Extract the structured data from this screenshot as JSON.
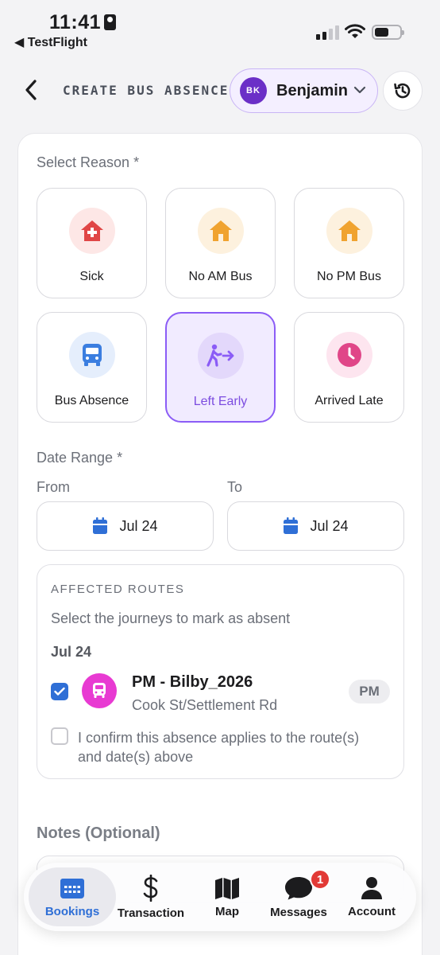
{
  "status_bar": {
    "time": "11:41",
    "back_app": "◀ TestFlight"
  },
  "header": {
    "title": "CREATE BUS ABSENCE",
    "user_initials": "BK",
    "user_name": "Benjamin"
  },
  "reason_section": {
    "label": "Select Reason *",
    "options": [
      {
        "label": "Sick",
        "icon": "house-medical-icon",
        "color": "#e04646",
        "bg": "#fde7e6",
        "selected": false
      },
      {
        "label": "No AM Bus",
        "icon": "house-icon",
        "color": "#f0a330",
        "bg": "#fdf1de",
        "selected": false
      },
      {
        "label": "No PM Bus",
        "icon": "house-icon",
        "color": "#f0a330",
        "bg": "#fdf1de",
        "selected": false
      },
      {
        "label": "Bus Absence",
        "icon": "bus-icon",
        "color": "#3b7ee0",
        "bg": "#e5eefc",
        "selected": false
      },
      {
        "label": "Left Early",
        "icon": "walking-person-icon",
        "color": "#8b5cf6",
        "bg": "#e3d8fb",
        "selected": true
      },
      {
        "label": "Arrived Late",
        "icon": "clock-icon",
        "color": "#e04688",
        "bg": "#fde5ef",
        "selected": false
      }
    ]
  },
  "date_section": {
    "label": "Date Range *",
    "from_label": "From",
    "to_label": "To",
    "from_value": "Jul 24",
    "to_value": "Jul 24"
  },
  "affected_routes": {
    "title": "AFFECTED ROUTES",
    "subtitle": "Select the journeys to mark as absent",
    "date": "Jul 24",
    "route": {
      "name": "PM - Bilby_2026",
      "stop": "Cook St/Settlement Rd",
      "badge": "PM",
      "checked": true
    },
    "confirm_text": "I confirm this absence applies to the route(s) and date(s) above",
    "confirm_checked": false
  },
  "notes": {
    "label": "Notes (Optional)"
  },
  "tab_bar": {
    "tabs": [
      {
        "label": "Bookings",
        "icon": "calendar-icon",
        "active": true
      },
      {
        "label": "Transaction",
        "icon": "dollar-icon",
        "active": false
      },
      {
        "label": "Map",
        "icon": "map-icon",
        "active": false
      },
      {
        "label": "Messages",
        "icon": "chat-bubble-icon",
        "active": false,
        "badge": "1"
      },
      {
        "label": "Account",
        "icon": "person-icon",
        "active": false
      }
    ]
  },
  "colors": {
    "accent": "#8b5cf6",
    "primary_blue": "#2f6fd6",
    "route_pink": "#e83ad2"
  }
}
